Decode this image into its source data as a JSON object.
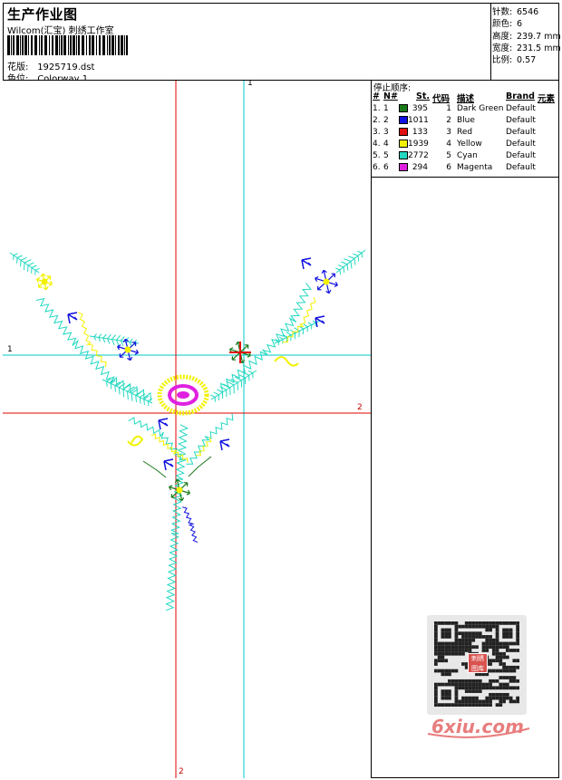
{
  "header": {
    "title": "生产作业图",
    "company": "Wilcom(汇宝) 刺绣工作室",
    "design_label": "花版:",
    "design_value": "1925719.dst",
    "colorway_label": "色位:",
    "colorway_value": "Colorway 1"
  },
  "stats": [
    {
      "key": "针数:",
      "value": "6546"
    },
    {
      "key": "颜色:",
      "value": "6"
    },
    {
      "key": "高度:",
      "value": "239.7 mm"
    },
    {
      "key": "宽度:",
      "value": "231.5 mm"
    },
    {
      "key": "比例:",
      "value": "0.57"
    }
  ],
  "stop_sequence": {
    "title": "停止顺序:",
    "headers": {
      "num": "#",
      "needle": "N#",
      "stitches": "St.",
      "code": "代码",
      "desc": "描述",
      "brand": "Brand",
      "element": "元素"
    },
    "rows": [
      {
        "num": "1.",
        "needle": "1",
        "color": "#1a7a1a",
        "stitches": "395",
        "code": "1",
        "desc": "Dark Green",
        "brand": "Default"
      },
      {
        "num": "2.",
        "needle": "2",
        "color": "#1010e0",
        "stitches": "1011",
        "code": "2",
        "desc": "Blue",
        "brand": "Default"
      },
      {
        "num": "3.",
        "needle": "3",
        "color": "#e01010",
        "stitches": "133",
        "code": "3",
        "desc": "Red",
        "brand": "Default"
      },
      {
        "num": "4.",
        "needle": "4",
        "color": "#f2f200",
        "stitches": "1939",
        "code": "4",
        "desc": "Yellow",
        "brand": "Default"
      },
      {
        "num": "5.",
        "needle": "5",
        "color": "#22d8c0",
        "stitches": "2772",
        "code": "5",
        "desc": "Cyan",
        "brand": "Default"
      },
      {
        "num": "6.",
        "needle": "6",
        "color": "#e020e0",
        "stitches": "294",
        "code": "6",
        "desc": "Magenta",
        "brand": "Default"
      }
    ]
  },
  "canvas": {
    "axis_labels": {
      "v_cyan_top": "1",
      "h_cyan_left": "1",
      "h_red_right": "2",
      "v_red_bottom": "2"
    }
  },
  "watermark": {
    "badge": "刺绣 图库",
    "text": "6xiu.com"
  }
}
